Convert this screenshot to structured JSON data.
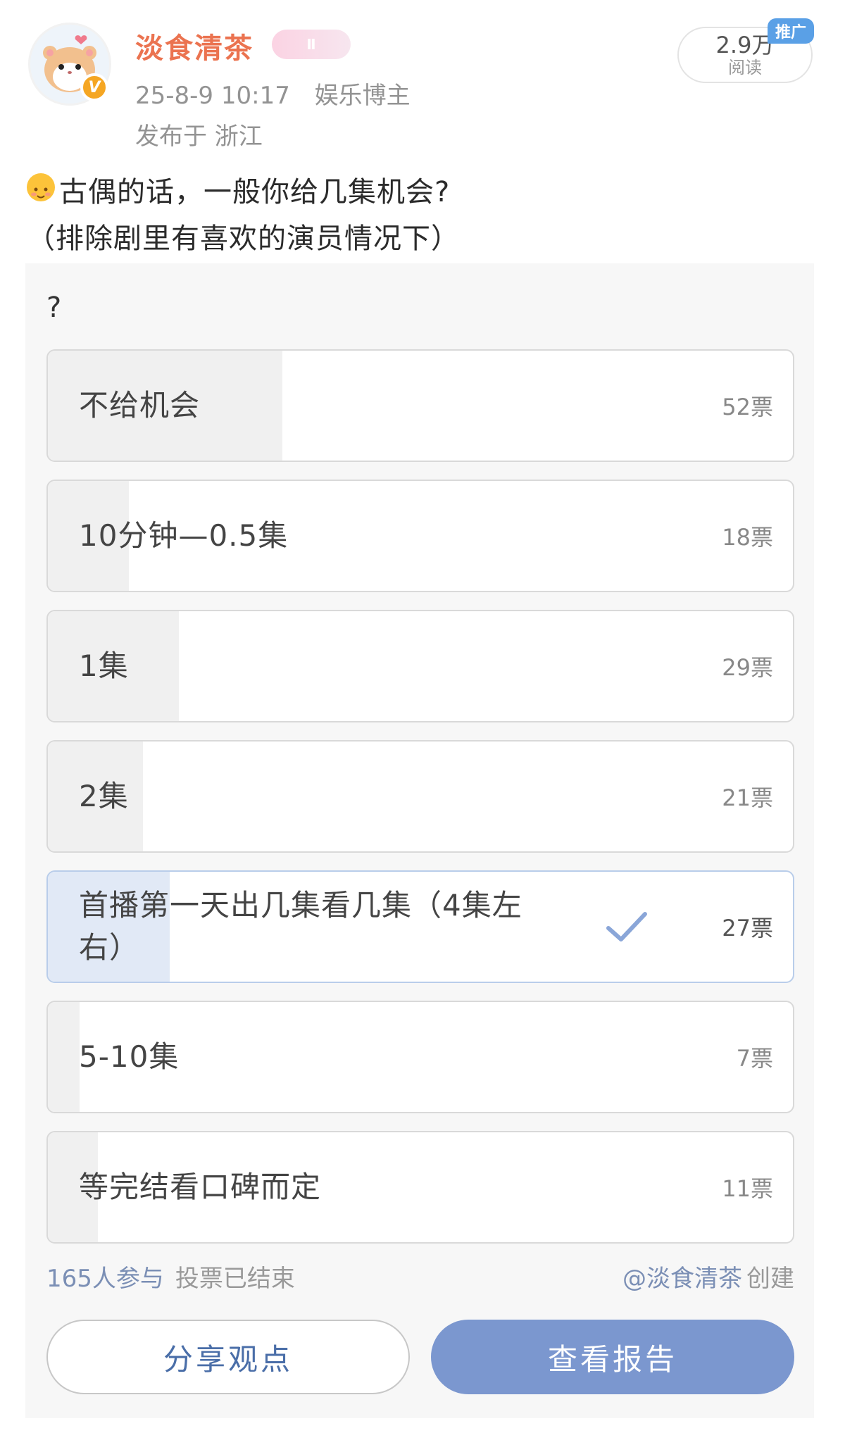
{
  "author": {
    "name": "淡食清茶",
    "timestamp": "25-8-9 10:17",
    "tag": "娱乐博主",
    "location": "发布于 浙江",
    "member_badge": "Ⅱ",
    "verified_badge": "V"
  },
  "stats": {
    "reads_count": "2.9万",
    "reads_label": "阅读",
    "promo_label": "推广"
  },
  "post": {
    "text_line1": "古偶的话，一般你给几集机会?",
    "text_line2": "（排除剧里有喜欢的演员情况下）"
  },
  "poll": {
    "question": "?",
    "total_votes": 165,
    "options": [
      {
        "label": "不给机会",
        "votes_text": "52票",
        "votes": 52,
        "voted": false
      },
      {
        "label": "10分钟—0.5集",
        "votes_text": "18票",
        "votes": 18,
        "voted": false
      },
      {
        "label": "1集",
        "votes_text": "29票",
        "votes": 29,
        "voted": false
      },
      {
        "label": "2集",
        "votes_text": "21票",
        "votes": 21,
        "voted": false
      },
      {
        "label": "首播第一天出几集看几集（4集左右）",
        "votes_text": "27票",
        "votes": 27,
        "voted": true
      },
      {
        "label": "5-10集",
        "votes_text": "7票",
        "votes": 7,
        "voted": false
      },
      {
        "label": "等完结看口碑而定",
        "votes_text": "11票",
        "votes": 11,
        "voted": false
      }
    ],
    "participants": "165人参与",
    "status": "投票已结束",
    "creator": "@淡食清茶",
    "creator_action": "创建",
    "share_button": "分享观点",
    "report_button": "查看报告"
  },
  "colors": {
    "username": "#eb7350",
    "link_blue": "#7b8fb5",
    "primary_button": "#7b97cf",
    "voted_fill": "#e1e9f6",
    "promo_tag": "#5aa0e6"
  },
  "icons": {
    "avatar": "hamster-avatar",
    "verified": "verified-badge-icon",
    "check": "check-icon",
    "emoji": "smile-emoji-icon"
  }
}
